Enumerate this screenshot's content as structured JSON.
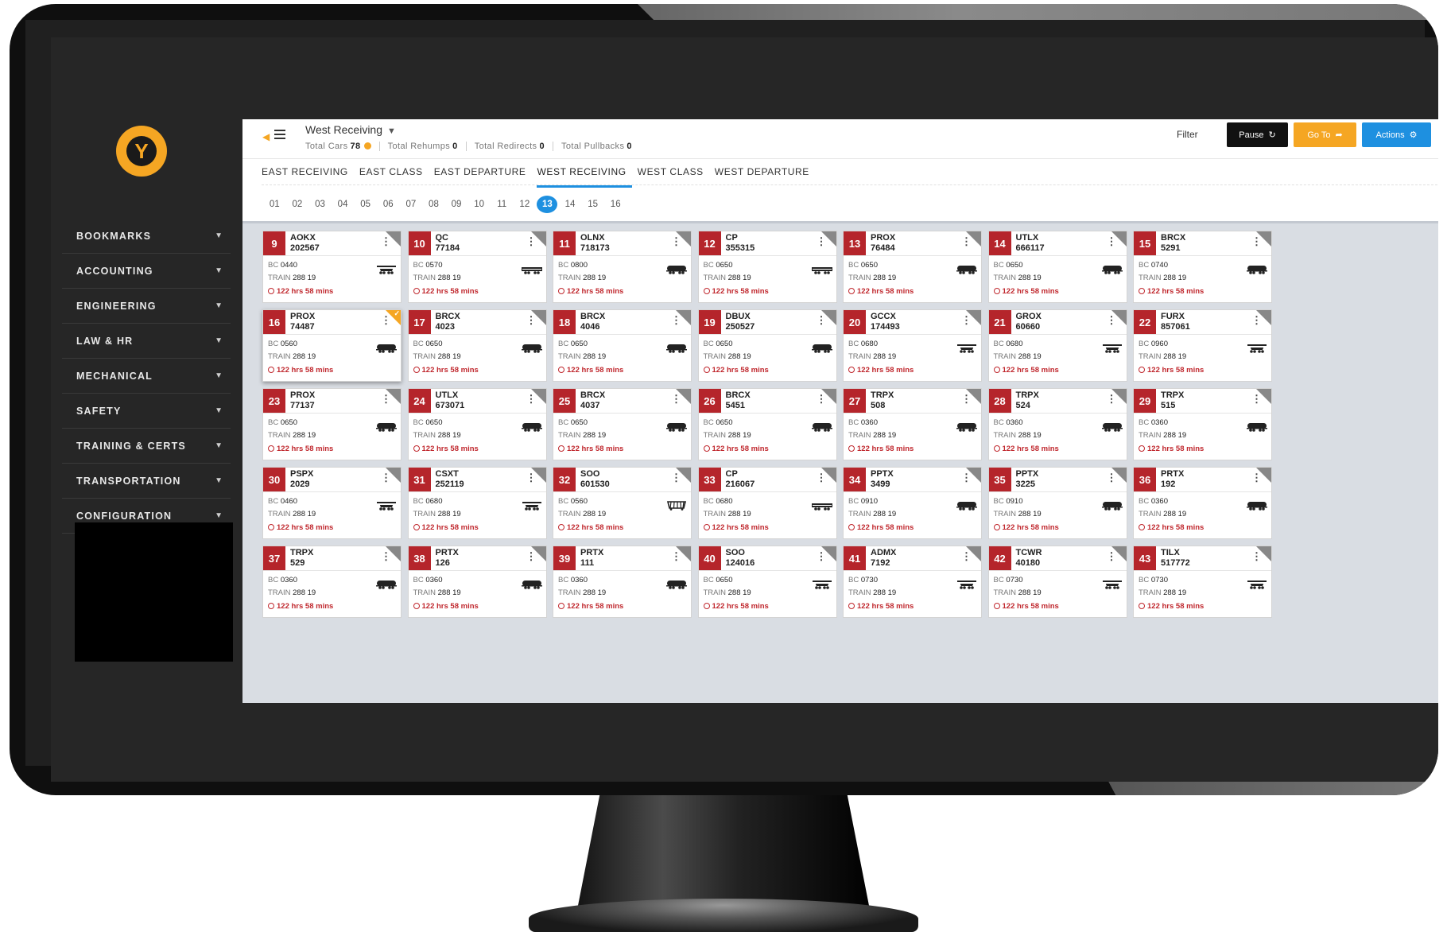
{
  "sidebar": {
    "items": [
      {
        "label": "BOOKMARKS"
      },
      {
        "label": "ACCOUNTING"
      },
      {
        "label": "ENGINEERING"
      },
      {
        "label": "LAW & HR"
      },
      {
        "label": "MECHANICAL"
      },
      {
        "label": "SAFETY"
      },
      {
        "label": "TRAINING & CERTS"
      },
      {
        "label": "TRANSPORTATION"
      },
      {
        "label": "CONFIGURATION"
      }
    ]
  },
  "header": {
    "yard": "West Receiving",
    "stats": [
      {
        "label": "Total Cars",
        "value": "78"
      },
      {
        "label": "Total Rehumps",
        "value": "0"
      },
      {
        "label": "Total Redirects",
        "value": "0"
      },
      {
        "label": "Total Pullbacks",
        "value": "0"
      }
    ],
    "filter_label": "Filter",
    "pause_label": "Pause",
    "goto_label": "Go To",
    "actions_label": "Actions"
  },
  "tabs": [
    "EAST RECEIVING",
    "EAST CLASS",
    "EAST DEPARTURE",
    "WEST RECEIVING",
    "WEST CLASS",
    "WEST DEPARTURE"
  ],
  "active_tab": "WEST RECEIVING",
  "pages": [
    "01",
    "02",
    "03",
    "04",
    "05",
    "06",
    "07",
    "08",
    "09",
    "10",
    "11",
    "12",
    "13",
    "14",
    "15",
    "16"
  ],
  "active_page": "13",
  "colors": {
    "accent_red": "#b5252b",
    "brand_gold": "#f5a623",
    "primary_blue": "#1e90e0"
  },
  "card_labels": {
    "bc": "BC",
    "train": "TRAIN"
  },
  "cars": [
    {
      "num": "9",
      "code": "AOKX",
      "id": "202567",
      "bc": "0440",
      "train": "288 19",
      "time": "122 hrs 58 mins",
      "icon": "gondola-car-icon"
    },
    {
      "num": "10",
      "code": "QC",
      "id": "77184",
      "bc": "0570",
      "train": "288 19",
      "time": "122 hrs 58 mins",
      "icon": "flat-car-icon"
    },
    {
      "num": "11",
      "code": "OLNX",
      "id": "718173",
      "bc": "0800",
      "train": "288 19",
      "time": "122 hrs 58 mins",
      "icon": "tank-car-icon"
    },
    {
      "num": "12",
      "code": "CP",
      "id": "355315",
      "bc": "0650",
      "train": "288 19",
      "time": "122 hrs 58 mins",
      "icon": "flat-car-icon"
    },
    {
      "num": "13",
      "code": "PROX",
      "id": "76484",
      "bc": "0650",
      "train": "288 19",
      "time": "122 hrs 58 mins",
      "icon": "tank-car-icon"
    },
    {
      "num": "14",
      "code": "UTLX",
      "id": "666117",
      "bc": "0650",
      "train": "288 19",
      "time": "122 hrs 58 mins",
      "icon": "tank-car-icon"
    },
    {
      "num": "15",
      "code": "BRCX",
      "id": "5291",
      "bc": "0740",
      "train": "288 19",
      "time": "122 hrs 58 mins",
      "icon": "tank-car-icon"
    },
    {
      "num": "16",
      "code": "PROX",
      "id": "74487",
      "bc": "0560",
      "train": "288 19",
      "time": "122 hrs 58 mins",
      "icon": "tank-car-icon",
      "selected": true
    },
    {
      "num": "17",
      "code": "BRCX",
      "id": "4023",
      "bc": "0650",
      "train": "288 19",
      "time": "122 hrs 58 mins",
      "icon": "tank-car-icon"
    },
    {
      "num": "18",
      "code": "BRCX",
      "id": "4046",
      "bc": "0650",
      "train": "288 19",
      "time": "122 hrs 58 mins",
      "icon": "tank-car-icon"
    },
    {
      "num": "19",
      "code": "DBUX",
      "id": "250527",
      "bc": "0650",
      "train": "288 19",
      "time": "122 hrs 58 mins",
      "icon": "tank-car-icon"
    },
    {
      "num": "20",
      "code": "GCCX",
      "id": "174493",
      "bc": "0680",
      "train": "288 19",
      "time": "122 hrs 58 mins",
      "icon": "gondola-car-icon"
    },
    {
      "num": "21",
      "code": "GROX",
      "id": "60660",
      "bc": "0680",
      "train": "288 19",
      "time": "122 hrs 58 mins",
      "icon": "gondola-car-icon"
    },
    {
      "num": "22",
      "code": "FURX",
      "id": "857061",
      "bc": "0960",
      "train": "288 19",
      "time": "122 hrs 58 mins",
      "icon": "gondola-car-icon"
    },
    {
      "num": "23",
      "code": "PROX",
      "id": "77137",
      "bc": "0650",
      "train": "288 19",
      "time": "122 hrs 58 mins",
      "icon": "tank-car-icon"
    },
    {
      "num": "24",
      "code": "UTLX",
      "id": "673071",
      "bc": "0650",
      "train": "288 19",
      "time": "122 hrs 58 mins",
      "icon": "tank-car-icon"
    },
    {
      "num": "25",
      "code": "BRCX",
      "id": "4037",
      "bc": "0650",
      "train": "288 19",
      "time": "122 hrs 58 mins",
      "icon": "tank-car-icon"
    },
    {
      "num": "26",
      "code": "BRCX",
      "id": "5451",
      "bc": "0650",
      "train": "288 19",
      "time": "122 hrs 58 mins",
      "icon": "tank-car-icon"
    },
    {
      "num": "27",
      "code": "TRPX",
      "id": "508",
      "bc": "0360",
      "train": "288 19",
      "time": "122 hrs 58 mins",
      "icon": "tank-car-icon"
    },
    {
      "num": "28",
      "code": "TRPX",
      "id": "524",
      "bc": "0360",
      "train": "288 19",
      "time": "122 hrs 58 mins",
      "icon": "tank-car-icon"
    },
    {
      "num": "29",
      "code": "TRPX",
      "id": "515",
      "bc": "0360",
      "train": "288 19",
      "time": "122 hrs 58 mins",
      "icon": "tank-car-icon"
    },
    {
      "num": "30",
      "code": "PSPX",
      "id": "2029",
      "bc": "0460",
      "train": "288 19",
      "time": "122 hrs 58 mins",
      "icon": "gondola-car-icon"
    },
    {
      "num": "31",
      "code": "CSXT",
      "id": "252119",
      "bc": "0680",
      "train": "288 19",
      "time": "122 hrs 58 mins",
      "icon": "gondola-car-icon"
    },
    {
      "num": "32",
      "code": "SOO",
      "id": "601530",
      "bc": "0560",
      "train": "288 19",
      "time": "122 hrs 58 mins",
      "icon": "hopper-car-icon"
    },
    {
      "num": "33",
      "code": "CP",
      "id": "216067",
      "bc": "0680",
      "train": "288 19",
      "time": "122 hrs 58 mins",
      "icon": "flat-car-icon"
    },
    {
      "num": "34",
      "code": "PPTX",
      "id": "3499",
      "bc": "0910",
      "train": "288 19",
      "time": "122 hrs 58 mins",
      "icon": "tank-car-icon"
    },
    {
      "num": "35",
      "code": "PPTX",
      "id": "3225",
      "bc": "0910",
      "train": "288 19",
      "time": "122 hrs 58 mins",
      "icon": "tank-car-icon"
    },
    {
      "num": "36",
      "code": "PRTX",
      "id": "192",
      "bc": "0360",
      "train": "288 19",
      "time": "122 hrs 58 mins",
      "icon": "tank-car-icon"
    },
    {
      "num": "37",
      "code": "TRPX",
      "id": "529",
      "bc": "0360",
      "train": "288 19",
      "time": "122 hrs 58 mins",
      "icon": "tank-car-icon"
    },
    {
      "num": "38",
      "code": "PRTX",
      "id": "126",
      "bc": "0360",
      "train": "288 19",
      "time": "122 hrs 58 mins",
      "icon": "tank-car-icon"
    },
    {
      "num": "39",
      "code": "PRTX",
      "id": "111",
      "bc": "0360",
      "train": "288 19",
      "time": "122 hrs 58 mins",
      "icon": "tank-car-icon"
    },
    {
      "num": "40",
      "code": "SOO",
      "id": "124016",
      "bc": "0650",
      "train": "288 19",
      "time": "122 hrs 58 mins",
      "icon": "gondola-car-icon"
    },
    {
      "num": "41",
      "code": "ADMX",
      "id": "7192",
      "bc": "0730",
      "train": "288 19",
      "time": "122 hrs 58 mins",
      "icon": "gondola-car-icon"
    },
    {
      "num": "42",
      "code": "TCWR",
      "id": "40180",
      "bc": "0730",
      "train": "288 19",
      "time": "122 hrs 58 mins",
      "icon": "gondola-car-icon"
    },
    {
      "num": "43",
      "code": "TILX",
      "id": "517772",
      "bc": "0730",
      "train": "288 19",
      "time": "122 hrs 58 mins",
      "icon": "gondola-car-icon"
    }
  ]
}
